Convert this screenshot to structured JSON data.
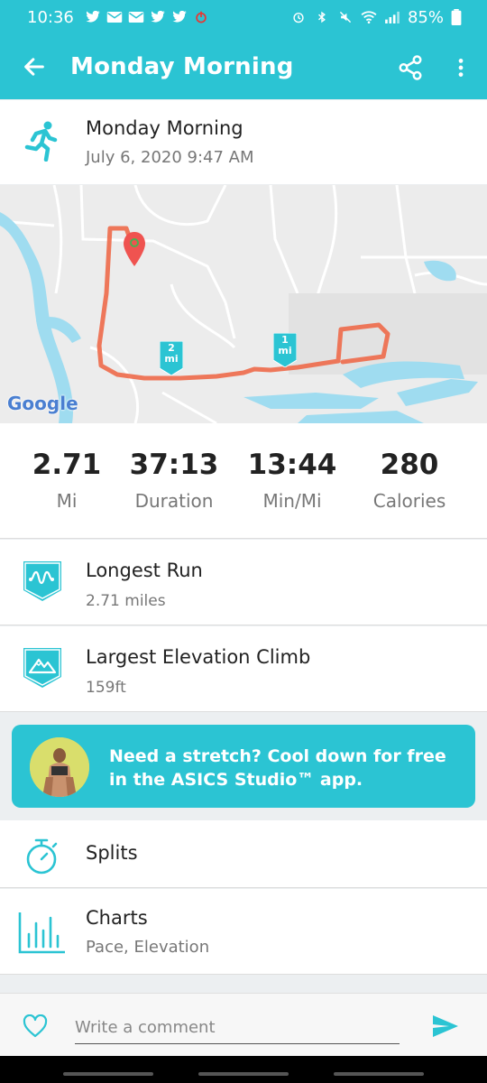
{
  "status_bar": {
    "time": "10:36",
    "battery": "85%",
    "left_icons": [
      "twitter-icon",
      "mail-icon",
      "mail-icon",
      "twitter-icon",
      "twitter-icon",
      "power-icon"
    ],
    "right_icons": [
      "alarm-icon",
      "bluetooth-icon",
      "mute-icon",
      "wifi-icon",
      "signal-icon",
      "battery-icon"
    ]
  },
  "app_bar": {
    "title": "Monday Morning",
    "icons": [
      "back-arrow-icon",
      "share-icon",
      "more-vert-icon"
    ]
  },
  "activity": {
    "name": "Monday Morning",
    "datetime": "July 6, 2020 9:47 AM",
    "icon": "runner-icon"
  },
  "map": {
    "attribution": "Google",
    "markers": [
      {
        "top": "2",
        "bottom": "mi"
      },
      {
        "top": "1",
        "bottom": "mi"
      }
    ]
  },
  "stats": [
    {
      "value": "2.71",
      "label": "Mi"
    },
    {
      "value": "37:13",
      "label": "Duration"
    },
    {
      "value": "13:44",
      "label": "Min/Mi"
    },
    {
      "value": "280",
      "label": "Calories"
    }
  ],
  "achievements": [
    {
      "title": "Longest Run",
      "detail": "2.71 miles",
      "icon": "longest-run-badge-icon"
    },
    {
      "title": "Largest Elevation Climb",
      "detail": "159ft",
      "icon": "elevation-badge-icon"
    }
  ],
  "promo": {
    "text": "Need a stretch? Cool down for free in the ASICS Studio™ app."
  },
  "sections": {
    "splits": {
      "title": "Splits",
      "icon": "stopwatch-icon"
    },
    "charts": {
      "title": "Charts",
      "subtitle": "Pace, Elevation",
      "icon": "bar-chart-icon"
    }
  },
  "comment": {
    "placeholder": "Write a comment",
    "icons": [
      "heart-icon",
      "send-icon"
    ]
  },
  "colors": {
    "accent": "#2bc4d3",
    "route": "#ee6a4a",
    "water": "#9fdcf0"
  }
}
